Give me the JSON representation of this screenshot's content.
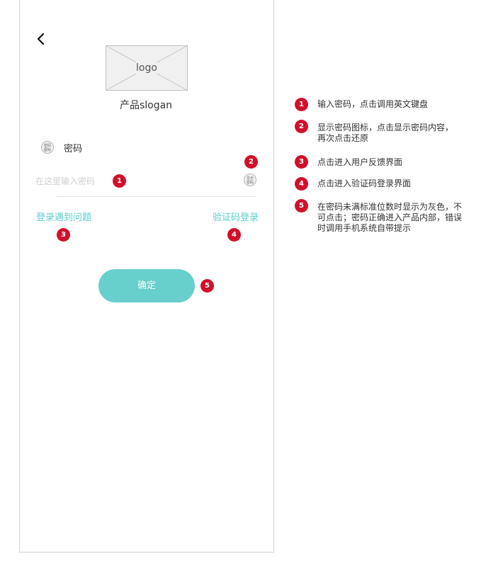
{
  "screen": {
    "logo_text": "logo",
    "slogan": "产品slogan",
    "password_icon_text": "密码\n图标",
    "password_label": "密码",
    "password_input": {
      "value": "",
      "placeholder": "在这里输入密码"
    },
    "show_password_icon_text": "显示\n密码",
    "help_link": "登录遇到问题",
    "sms_login_link": "验证码登录",
    "confirm_button": "确定"
  },
  "markers": [
    "1",
    "2",
    "3",
    "4",
    "5"
  ],
  "notes": [
    {
      "num": "1",
      "text": "输入密码，点击调用英文键盘"
    },
    {
      "num": "2",
      "text": "显示密码图标，点击显示密码内容，再次点击还原"
    },
    {
      "num": "3",
      "text": "点击进入用户反馈界面"
    },
    {
      "num": "4",
      "text": "点击进入验证码登录界面"
    },
    {
      "num": "5",
      "text": "在密码未满标准位数时显示为灰色，不可点击；密码正确进入产品内部，错误时调用手机系统自带提示"
    }
  ],
  "colors": {
    "accent": "#67cfcc",
    "link": "#5bcdcb",
    "marker": "#d0112b"
  }
}
